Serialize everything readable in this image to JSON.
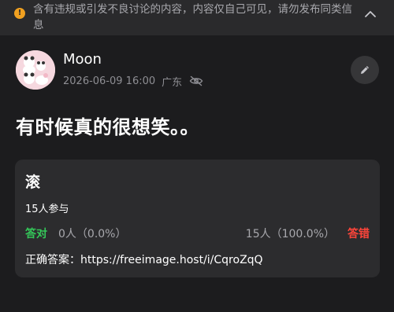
{
  "banner": {
    "icon": "warning-icon",
    "text": "含有违规或引发不良讨论的内容，内容仅自己可见，请勿发布同类信息",
    "collapse_icon": "chevron-up-icon",
    "warn_color": "#f0a020"
  },
  "post": {
    "username": "Moon",
    "datetime": "2026-06-09 16:00",
    "location": "广东",
    "visibility_icon": "eye-slash-icon",
    "edit_icon": "pencil-icon",
    "text": "有时候真的很想笑。。"
  },
  "poll": {
    "title": "滚",
    "participants": "15人参与",
    "correct_label": "答对",
    "correct_stat": "0人（0.0%）",
    "wrong_stat": "15人（100.0%）",
    "wrong_label": "答错",
    "answer_label": "正确答案：",
    "answer_value": "https://freeimage.host/i/CqroZqQ",
    "correct_color": "#34c759",
    "wrong_color": "#ff453a"
  }
}
